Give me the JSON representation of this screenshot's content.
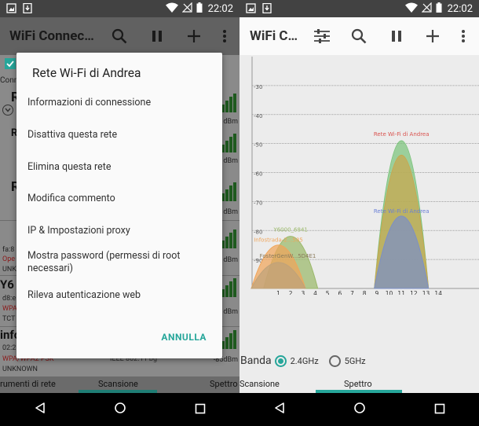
{
  "status_time": "22:02",
  "left": {
    "app_title": "WiFi Connec…",
    "dialog": {
      "title": "Rete Wi-Fi di Andrea",
      "items": [
        "Informazioni di connessione",
        "Disattiva questa rete",
        "Elimina questa rete",
        "Modifica commento",
        "IP & Impostazioni proxy",
        "Mostra password (permessi di root necessari)",
        "Rileva autenticazione web"
      ],
      "cancel_label": "ANNULLA"
    },
    "background": {
      "conn_prefix": "Conn",
      "initial_r1": "R",
      "initial_r2": "R",
      "initial_r3": "R",
      "fragment_fa": "fa:8",
      "fragment_ope": "Ope",
      "fragment_unk": "UNK",
      "fragment_y6": "Y6",
      "fragment_d8": "d8:e",
      "fragment_wp": "WPA",
      "fragment_tct": "TCT",
      "fragment_info": "info",
      "fragment_02": "02:2",
      "security": "WPA/WPA2 PSK",
      "standard": "IEEE 802.11 bg",
      "unknown": "UNKNOWN",
      "dbm": [
        "dBm",
        "dBm",
        "dBm",
        "dBm",
        "dBm",
        "dBm"
      ],
      "last_dbm": "-85dBm"
    },
    "tabs": [
      "rumenti di rete",
      "Scansione",
      "Spettro"
    ]
  },
  "right": {
    "app_title": "WiFi C…",
    "band_label": "Banda",
    "band_options": [
      "2.4GHz",
      "5GHz"
    ],
    "tabs": [
      "Scansione",
      "Spettro"
    ]
  },
  "chart_data": {
    "type": "area",
    "xlabel": "",
    "ylabel": "",
    "x_ticks": [
      "1",
      "2",
      "3",
      "4",
      "5",
      "6",
      "7",
      "8",
      "9",
      "10",
      "11",
      "12",
      "13",
      "14"
    ],
    "y_ticks": [
      "-30",
      "-40",
      "-50",
      "-60",
      "-70",
      "-80",
      "-90"
    ],
    "ylim": [
      -100,
      -20
    ],
    "grid": "horizontal",
    "series": [
      {
        "name": "Rete Wi-Fi di Andrea",
        "channel": 11,
        "peak_dbm": -49,
        "color": "#7cc47c"
      },
      {
        "name": "",
        "channel": 11,
        "peak_dbm": -54,
        "color": "#c9a64d"
      },
      {
        "name": "Rete Wi-Fi di Andrea",
        "channel": 11,
        "peak_dbm": -75,
        "color": "#7b8fc7"
      },
      {
        "name": "Y6000_6841",
        "channel": 2,
        "peak_dbm": -82,
        "color": "#9ab86a"
      },
      {
        "name": "Infostrada-2...585",
        "channel": 1,
        "peak_dbm": -85,
        "color": "#f0a55a"
      },
      {
        "name": "FosterGenW...5D4E1",
        "channel": 1,
        "peak_dbm": -91,
        "color": "#bfa27a"
      }
    ]
  }
}
